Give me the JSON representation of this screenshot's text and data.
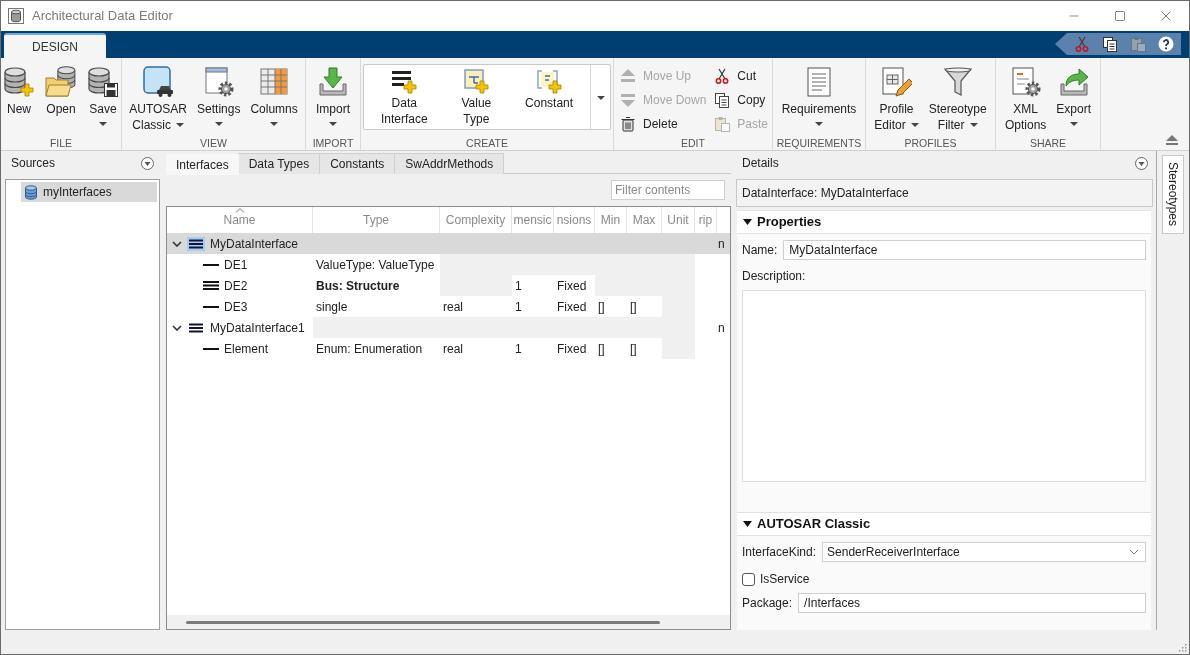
{
  "window": {
    "title": "Architectural Data Editor"
  },
  "ribbon": {
    "tabs": [
      {
        "label": "DESIGN",
        "selected": true
      }
    ],
    "quick_access": [
      {
        "disabled": false
      },
      {
        "disabled": false
      },
      {
        "disabled": true
      },
      {
        "disabled": false
      }
    ],
    "groups": [
      {
        "label": "FILE",
        "kind": "buttons",
        "controls": [
          {
            "lines": [
              "New"
            ],
            "dropdown": false
          },
          {
            "lines": [
              "Open"
            ],
            "dropdown": false
          },
          {
            "lines": [
              "Save"
            ],
            "dropdown": true
          }
        ]
      },
      {
        "label": "VIEW",
        "kind": "buttons",
        "controls": [
          {
            "lines": [
              "AUTOSAR",
              "Classic"
            ],
            "dropdown": true
          },
          {
            "lines": [
              "Settings"
            ],
            "dropdown": true
          },
          {
            "lines": [
              "Columns"
            ],
            "dropdown": true
          }
        ]
      },
      {
        "label": "IMPORT",
        "kind": "buttons",
        "controls": [
          {
            "lines": [
              "Import"
            ],
            "dropdown": true
          }
        ]
      },
      {
        "label": "CREATE",
        "kind": "gallery",
        "controls": [
          {
            "lines": [
              "Data",
              "Interface"
            ]
          },
          {
            "lines": [
              "Value",
              "Type"
            ]
          },
          {
            "lines": [
              "Constant"
            ]
          }
        ]
      },
      {
        "label": "EDIT",
        "kind": "stack",
        "controls": [
          {
            "label": "Move Up",
            "disabled": true
          },
          {
            "label": "Move Down",
            "disabled": true
          },
          {
            "label": "Delete",
            "disabled": false
          },
          {
            "label": "Cut",
            "disabled": false
          },
          {
            "label": "Copy",
            "disabled": false
          },
          {
            "label": "Paste",
            "disabled": true
          }
        ]
      },
      {
        "label": "REQUIREMENTS",
        "kind": "buttons",
        "controls": [
          {
            "lines": [
              "Requirements"
            ],
            "dropdown": true
          }
        ]
      },
      {
        "label": "PROFILES",
        "kind": "buttons",
        "controls": [
          {
            "lines": [
              "Profile",
              "Editor"
            ],
            "dropdown": true
          },
          {
            "lines": [
              "Stereotype",
              "Filter"
            ],
            "dropdown": true
          }
        ]
      },
      {
        "label": "SHARE",
        "kind": "buttons",
        "controls": [
          {
            "lines": [
              "XML",
              "Options"
            ],
            "dropdown": false
          },
          {
            "lines": [
              "Export"
            ],
            "dropdown": true
          }
        ]
      }
    ]
  },
  "sources": {
    "title": "Sources",
    "items": [
      {
        "label": "myInterfaces",
        "selected": true
      }
    ]
  },
  "center": {
    "tabs": [
      {
        "label": "Interfaces",
        "selected": true
      },
      {
        "label": "Data Types",
        "selected": false
      },
      {
        "label": "Constants",
        "selected": false
      },
      {
        "label": "SwAddrMethods",
        "selected": false
      }
    ],
    "filter": {
      "placeholder": "Filter contents"
    },
    "table": {
      "columns": [
        {
          "label": "Name",
          "sorted": true
        },
        {
          "label": "Type",
          "sorted": false
        },
        {
          "label": "Complexity",
          "sorted": false
        },
        {
          "label": "mensic",
          "sorted": false
        },
        {
          "label": "nsions",
          "sorted": false
        },
        {
          "label": "Min",
          "sorted": false
        },
        {
          "label": "Max",
          "sorted": false
        },
        {
          "label": "Unit",
          "sorted": false
        },
        {
          "label": "rip",
          "sorted": false
        }
      ],
      "rows": [
        {
          "kind": "interface",
          "selected": true,
          "expanded": true,
          "cells": {
            "name": "MyDataInterface",
            "column_10": "n"
          },
          "children": [
            {
              "kind": "element",
              "selected": false,
              "cells": {
                "name": "DE1",
                "type": "ValueType: ValueType"
              }
            },
            {
              "kind": "bus_element",
              "selected": false,
              "cells": {
                "name": "DE2",
                "type": "Bus: Structure",
                "column_4": "1",
                "column_5": "Fixed"
              }
            },
            {
              "kind": "element",
              "selected": false,
              "cells": {
                "name": "DE3",
                "type": "single",
                "complexity": "real",
                "column_4": "1",
                "column_5": "Fixed",
                "min": "[]",
                "max": "[]"
              }
            }
          ]
        },
        {
          "kind": "interface",
          "selected": false,
          "expanded": true,
          "cells": {
            "name": "MyDataInterface1",
            "column_10": "n"
          },
          "children": [
            {
              "kind": "element",
              "selected": false,
              "cells": {
                "name": "Element",
                "type": "Enum: Enumeration",
                "complexity": "real",
                "column_4": "1",
                "column_5": "Fixed",
                "min": "[]",
                "max": "[]"
              }
            }
          ]
        }
      ]
    }
  },
  "details": {
    "title": "Details",
    "heading": "DataInterface: MyDataInterface",
    "sections": [
      {
        "title": "Properties",
        "expanded": true,
        "fields": [
          {
            "kind": "text",
            "label": "Name:",
            "value": "MyDataInterface"
          },
          {
            "kind": "textarea",
            "label": "Description:"
          }
        ]
      },
      {
        "title": "AUTOSAR Classic",
        "expanded": true,
        "fields": [
          {
            "kind": "select",
            "label": "InterfaceKind:",
            "value": "SenderReceiverInterface"
          },
          {
            "kind": "checkbox",
            "label": "IsService",
            "checked": false
          },
          {
            "kind": "text",
            "label": "Package:",
            "value": "/Interfaces"
          }
        ]
      }
    ]
  },
  "side_tabs": [
    {
      "label": "Stereotypes"
    }
  ]
}
